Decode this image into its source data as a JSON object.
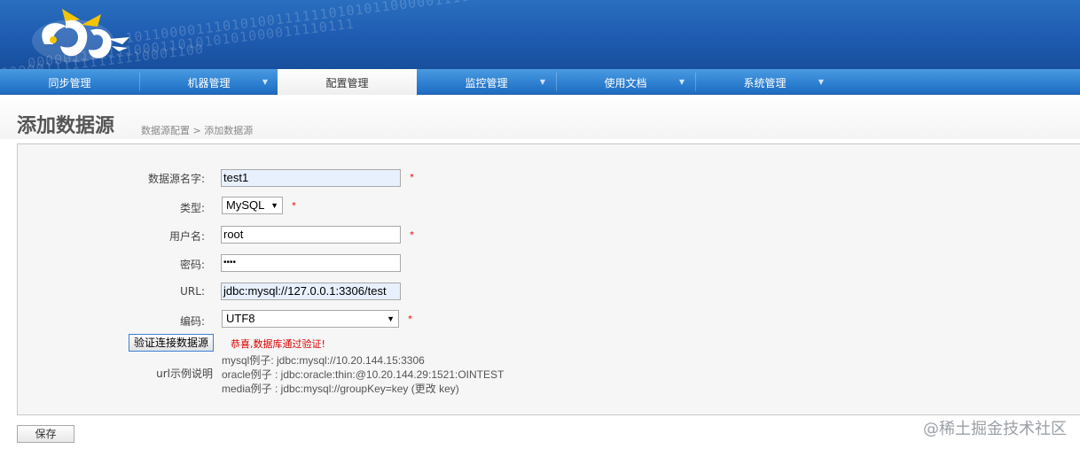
{
  "header": {
    "binary_1": "0000011111110001101010101000011110111",
    "binary_2": "1011000011101010011111101010110000011101011",
    "binary_3": "00000111111111110001100"
  },
  "nav": {
    "items": [
      {
        "label": "同步管理",
        "has_dropdown": false,
        "active": false
      },
      {
        "label": "机器管理",
        "has_dropdown": true,
        "active": false
      },
      {
        "label": "配置管理",
        "has_dropdown": true,
        "active": true
      },
      {
        "label": "监控管理",
        "has_dropdown": true,
        "active": false
      },
      {
        "label": "使用文档",
        "has_dropdown": true,
        "active": false
      },
      {
        "label": "系统管理",
        "has_dropdown": true,
        "active": false
      }
    ],
    "caret": "▼"
  },
  "page": {
    "title": "添加数据源",
    "breadcrumb": "数据源配置 > 添加数据源"
  },
  "form": {
    "name_label": "数据源名字:",
    "name_value": "test1",
    "type_label": "类型:",
    "type_value": "MySQL",
    "username_label": "用户名:",
    "username_value": "root",
    "password_label": "密码:",
    "password_value": "••••",
    "url_label": "URL:",
    "url_value": "jdbc:mysql://127.0.0.1:3306/test",
    "encoding_label": "编码:",
    "encoding_value": "UTF8",
    "required_mark": "*",
    "verify_button": "验证连接数据源",
    "verify_message": "恭喜,数据库通过验证!",
    "url_help_label": "url示例说明",
    "url_examples": [
      "mysql例子: jdbc:mysql://10.20.144.15:3306",
      "oracle例子 : jdbc:oracle:thin:@10.20.144.29:1521:OINTEST",
      "media例子 : jdbc:mysql://groupKey=key (更改 key)"
    ],
    "save_button": "保存"
  },
  "watermark": "@稀土掘金技术社区",
  "colors": {
    "banner": "#1e5bb0",
    "nav": "#2d7fd0",
    "required": "#ee0000",
    "success": "#dd0000"
  }
}
